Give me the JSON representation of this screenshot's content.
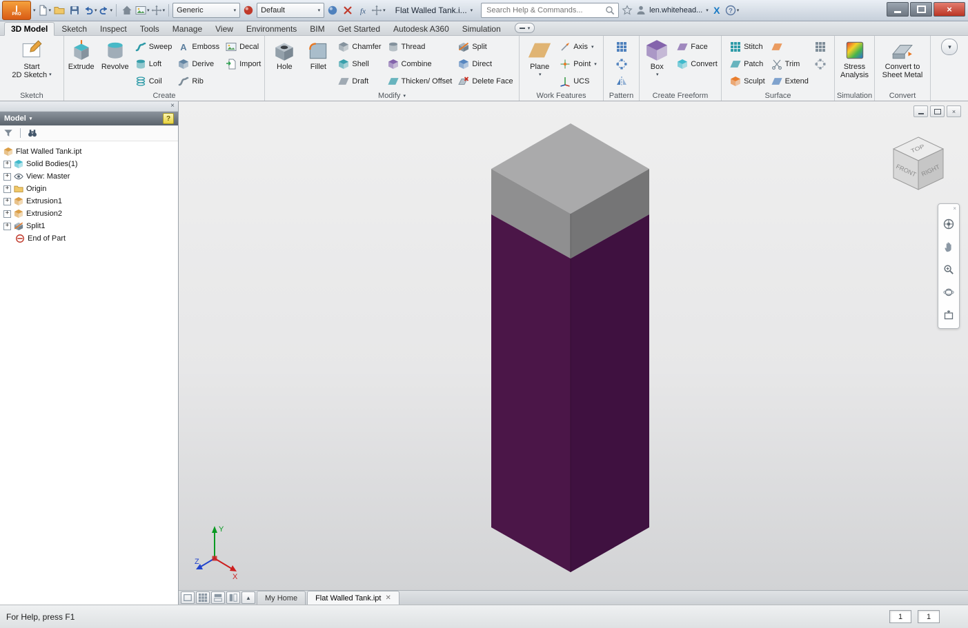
{
  "titlebar": {
    "doc_title": "Flat Walled Tank.i...",
    "search_placeholder": "Search Help & Commands...",
    "user": "len.whitehead...",
    "material": "Generic",
    "appearance": "Default"
  },
  "tabs": [
    "3D Model",
    "Sketch",
    "Inspect",
    "Tools",
    "Manage",
    "View",
    "Environments",
    "BIM",
    "Get Started",
    "Autodesk A360",
    "Simulation"
  ],
  "ribbon": {
    "sketch": {
      "panel": "Sketch",
      "start2d_line1": "Start",
      "start2d_line2": "2D Sketch"
    },
    "create": {
      "panel": "Create",
      "extrude": "Extrude",
      "revolve": "Revolve",
      "sweep": "Sweep",
      "loft": "Loft",
      "coil": "Coil",
      "emboss": "Emboss",
      "derive": "Derive",
      "rib": "Rib",
      "decal": "Decal",
      "import": "Import"
    },
    "modify": {
      "panel": "Modify",
      "hole": "Hole",
      "fillet": "Fillet",
      "chamfer": "Chamfer",
      "shell": "Shell",
      "draft": "Draft",
      "thread": "Thread",
      "combine": "Combine",
      "thicken": "Thicken/ Offset",
      "split": "Split",
      "direct": "Direct",
      "delete_face": "Delete Face"
    },
    "work": {
      "panel": "Work Features",
      "plane": "Plane",
      "axis": "Axis",
      "point": "Point",
      "ucs": "UCS"
    },
    "pattern": {
      "panel": "Pattern"
    },
    "freeform": {
      "panel": "Create Freeform",
      "box": "Box",
      "face": "Face",
      "convert": "Convert"
    },
    "surface": {
      "panel": "Surface",
      "stitch": "Stitch",
      "patch": "Patch",
      "sculpt": "Sculpt",
      "trim": "Trim",
      "extend": "Extend"
    },
    "simulation": {
      "panel": "Simulation",
      "stress_line1": "Stress",
      "stress_line2": "Analysis"
    },
    "convert": {
      "panel": "Convert",
      "line1": "Convert to",
      "line2": "Sheet Metal"
    }
  },
  "browser": {
    "title": "Model",
    "tree": [
      {
        "label": "Flat Walled Tank.ipt"
      },
      {
        "label": "Solid Bodies(1)"
      },
      {
        "label": "View: Master"
      },
      {
        "label": "Origin"
      },
      {
        "label": "Extrusion1"
      },
      {
        "label": "Extrusion2"
      },
      {
        "label": "Split1"
      },
      {
        "label": "End of Part"
      }
    ]
  },
  "viewcube": {
    "top": "TOP",
    "front": "FRONT",
    "right": "RIGHT"
  },
  "doc_tabs": {
    "home": "My Home",
    "part": "Flat Walled Tank.ipt"
  },
  "statusbar": {
    "help": "For Help, press F1",
    "cell1": "1",
    "cell2": "1"
  },
  "colors": {
    "accent_orange": "#e87722",
    "tank_top": "#aaaaab",
    "tank_gray_left": "#8f8f90",
    "tank_gray_right": "#757576",
    "tank_purple_left": "#4b1648",
    "tank_purple_right": "#3f1140"
  }
}
